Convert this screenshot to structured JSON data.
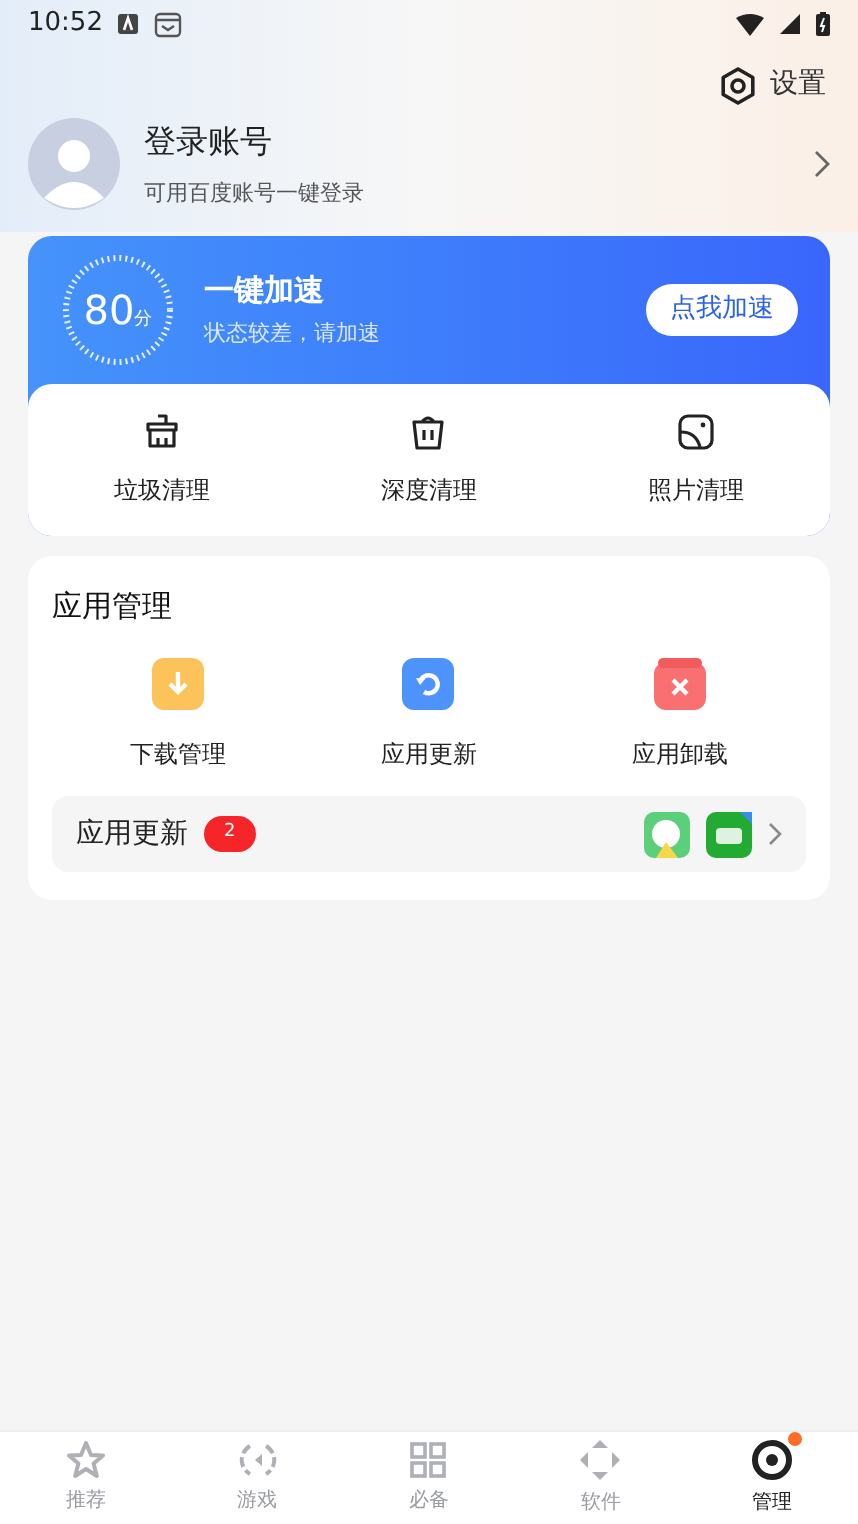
{
  "status_bar": {
    "time": "10:52"
  },
  "settings": {
    "label": "设置"
  },
  "account": {
    "title": "登录账号",
    "subtitle": "可用百度账号一键登录"
  },
  "boost": {
    "score": "80",
    "unit": "分",
    "title": "一键加速",
    "subtitle": "状态较差，请加速",
    "button": "点我加速"
  },
  "cleanup": [
    {
      "kind": "junk",
      "label": "垃圾清理"
    },
    {
      "kind": "deep",
      "label": "深度清理"
    },
    {
      "kind": "photo",
      "label": "照片清理"
    }
  ],
  "app_management": {
    "title": "应用管理",
    "items": [
      {
        "kind": "download",
        "label": "下载管理"
      },
      {
        "kind": "update",
        "label": "应用更新"
      },
      {
        "kind": "uninstall",
        "label": "应用卸载"
      }
    ],
    "updates_row": {
      "label": "应用更新",
      "count": "2"
    }
  },
  "bottom_nav": [
    {
      "kind": "star",
      "label": "推荐",
      "selected": false,
      "badge": false
    },
    {
      "kind": "game",
      "label": "游戏",
      "selected": false,
      "badge": false
    },
    {
      "kind": "grid",
      "label": "必备",
      "selected": false,
      "badge": false
    },
    {
      "kind": "diamond",
      "label": "软件",
      "selected": false,
      "badge": false
    },
    {
      "kind": "manage",
      "label": "管理",
      "selected": true,
      "badge": true
    }
  ]
}
